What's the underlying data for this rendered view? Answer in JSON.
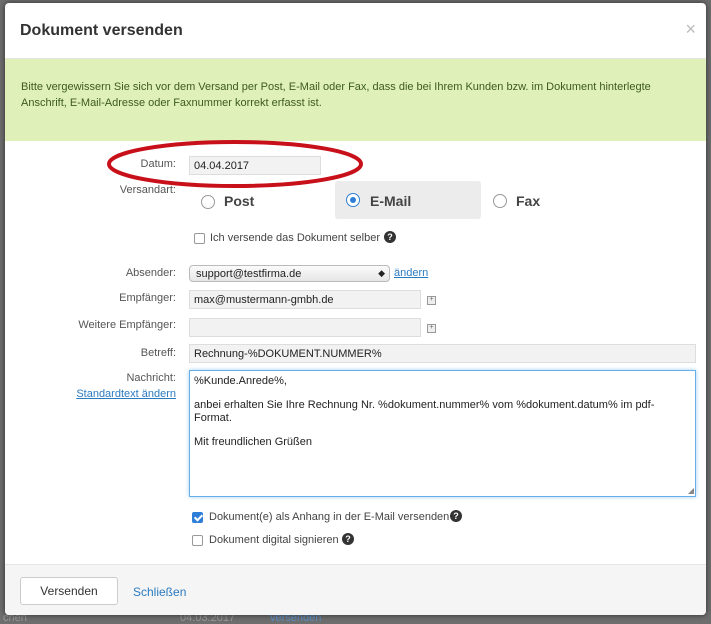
{
  "backdrop": {
    "left_text": "chen",
    "bottom_text": "04.03.2017",
    "bottom_link": "versenden"
  },
  "dialog": {
    "title": "Dokument versenden",
    "close_symbol": "×",
    "notice": "Bitte vergewissern Sie sich vor dem Versand per Post, E-Mail oder Fax, dass die bei Ihrem Kunden bzw. im Dokument hinterlegte Anschrift, E-Mail-Adresse oder Faxnummer korrekt erfasst ist.",
    "notice_color": "#dff0b8",
    "highlight_color": "#cc0000"
  },
  "form": {
    "date_label": "Datum:",
    "date_value": "04.04.2017",
    "method_label": "Versandart:",
    "methods": [
      {
        "label": "Post",
        "selected": false
      },
      {
        "label": "E-Mail",
        "selected": true
      },
      {
        "label": "Fax",
        "selected": false
      }
    ],
    "self_send_label": "Ich versende das Dokument selber",
    "self_send_checked": false,
    "sender_label": "Absender:",
    "sender_value": "support@testfirma.de",
    "change_link": "ändern",
    "recipient_label": "Empfänger:",
    "recipient_value": "max@mustermann-gmbh.de",
    "cc_label": "Weitere Empfänger:",
    "cc_value": "",
    "subject_label": "Betreff:",
    "subject_value": "Rechnung-%DOKUMENT.NUMMER%",
    "message_label": "Nachricht:",
    "default_text_link": "Standardtext ändern",
    "message_lines": [
      "%Kunde.Anrede%,",
      "anbei erhalten Sie Ihre Rechnung Nr. %dokument.nummer% vom %dokument.datum% im pdf-Format.",
      "Mit freundlichen Grüßen"
    ],
    "attach_label": "Dokument(e) als Anhang in der E-Mail versenden",
    "attach_checked": true,
    "sign_label": "Dokument digital signieren",
    "sign_checked": false,
    "help_symbol": "?",
    "plus_symbol": "+"
  },
  "footer": {
    "send_button": "Versenden",
    "close_link": "Schließen"
  }
}
